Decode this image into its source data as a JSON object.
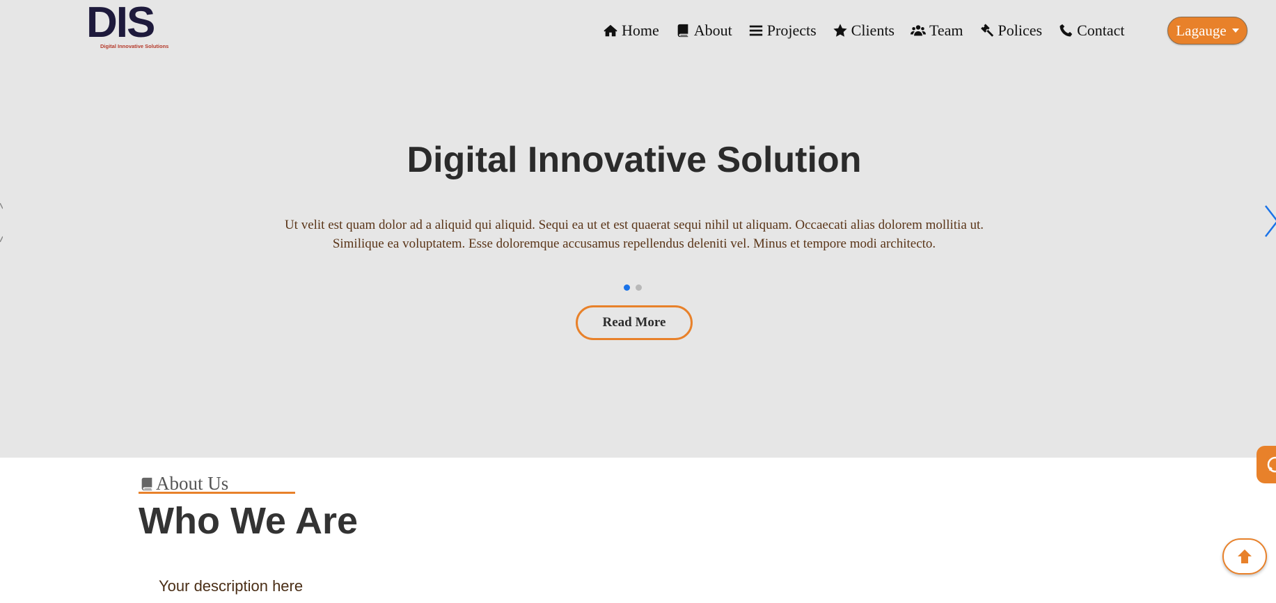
{
  "logo": {
    "mark": "DIS",
    "tagline": "Digital Innovative Solutions"
  },
  "nav": [
    {
      "label": "Home",
      "icon": "home-icon"
    },
    {
      "label": "About",
      "icon": "book-icon"
    },
    {
      "label": "Projects",
      "icon": "bars-icon"
    },
    {
      "label": "Clients",
      "icon": "star-icon"
    },
    {
      "label": "Team",
      "icon": "users-icon"
    },
    {
      "label": "Polices",
      "icon": "gavel-icon"
    },
    {
      "label": "Contact",
      "icon": "phone-icon"
    }
  ],
  "language_button": {
    "label": "Lagauge"
  },
  "slide": {
    "title": "Digital Innovative Solution",
    "text": "Ut velit est quam dolor ad a aliquid qui aliquid. Sequi ea ut et est quaerat sequi nihil ut aliquam. Occaecati alias dolorem mollitia ut. Similique ea voluptatem. Esse doloremque accusamus repellendus deleniti vel. Minus et tempore modi architecto.",
    "button": "Read More",
    "slides_count": 2,
    "active_slide": 1
  },
  "about": {
    "label": "About Us",
    "heading": "Who We Are",
    "description": "Your description here"
  },
  "colors": {
    "accent": "#e8812a",
    "hero_bg": "#e6e6e6",
    "dot_active": "#1a73e8",
    "carousel_arrow": "#1a73e8"
  }
}
